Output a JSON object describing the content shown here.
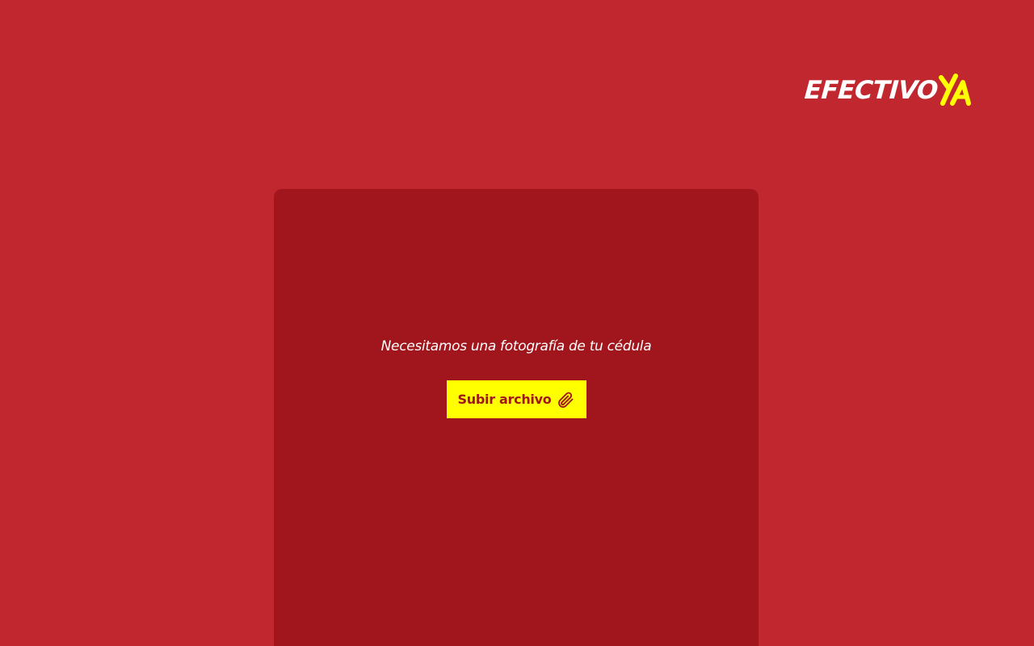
{
  "brand": {
    "logo_main": "EFECTIVO",
    "logo_accent": "YA",
    "colors": {
      "background": "#c1272f",
      "card": "#a0161c",
      "accent": "#ffff00",
      "text": "#ffffff"
    }
  },
  "card": {
    "prompt": "Necesitamos una fotografía de tu cédula",
    "upload_button": {
      "label": "Subir archivo",
      "icon": "paperclip-icon"
    }
  }
}
